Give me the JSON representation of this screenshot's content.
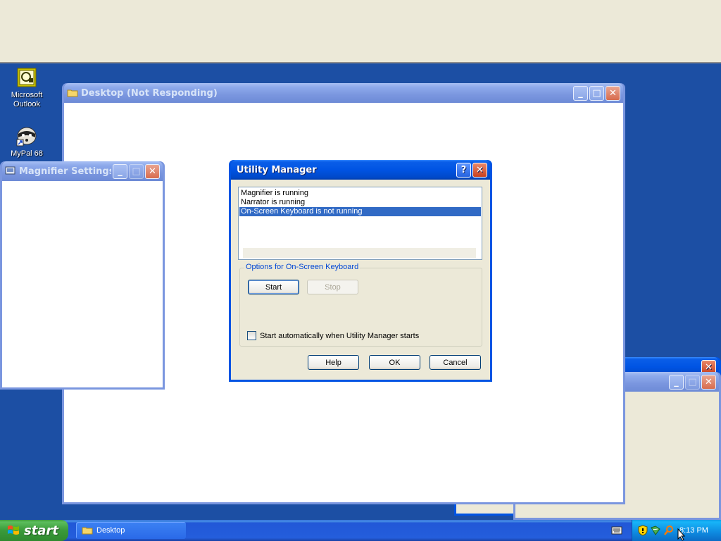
{
  "desktop_icons": [
    {
      "label_line1": "Microsoft",
      "label_line2": "Outlook",
      "icon": "outlook-icon"
    },
    {
      "label_line1": "MyPal 68",
      "label_line2": "",
      "icon": "mypal-icon"
    }
  ],
  "desktop_window": {
    "title": "Desktop (Not Responding)"
  },
  "magnifier_window": {
    "title": "Magnifier Settings"
  },
  "utility_manager": {
    "title": "Utility Manager",
    "list": [
      "Magnifier is running",
      "Narrator is running",
      "On-Screen Keyboard is not running"
    ],
    "selected_index": 2,
    "group_label": "Options for On-Screen Keyboard",
    "start_label": "Start",
    "stop_label": "Stop",
    "checkbox_label": "Start automatically when Utility Manager starts",
    "checkbox_checked": false,
    "help_label": "Help",
    "ok_label": "OK",
    "cancel_label": "Cancel"
  },
  "taskbar": {
    "start_label": "start",
    "task_buttons": [
      {
        "label": "Desktop",
        "icon": "folder-icon"
      }
    ],
    "tray_icons": [
      "security-shield-icon",
      "network-icon",
      "magnifier-icon"
    ],
    "clock": "8:13 PM"
  },
  "colors": {
    "desktop_bg": "#1c4fa4",
    "titlebar_active": "#0054e3",
    "selection": "#316ac5"
  }
}
